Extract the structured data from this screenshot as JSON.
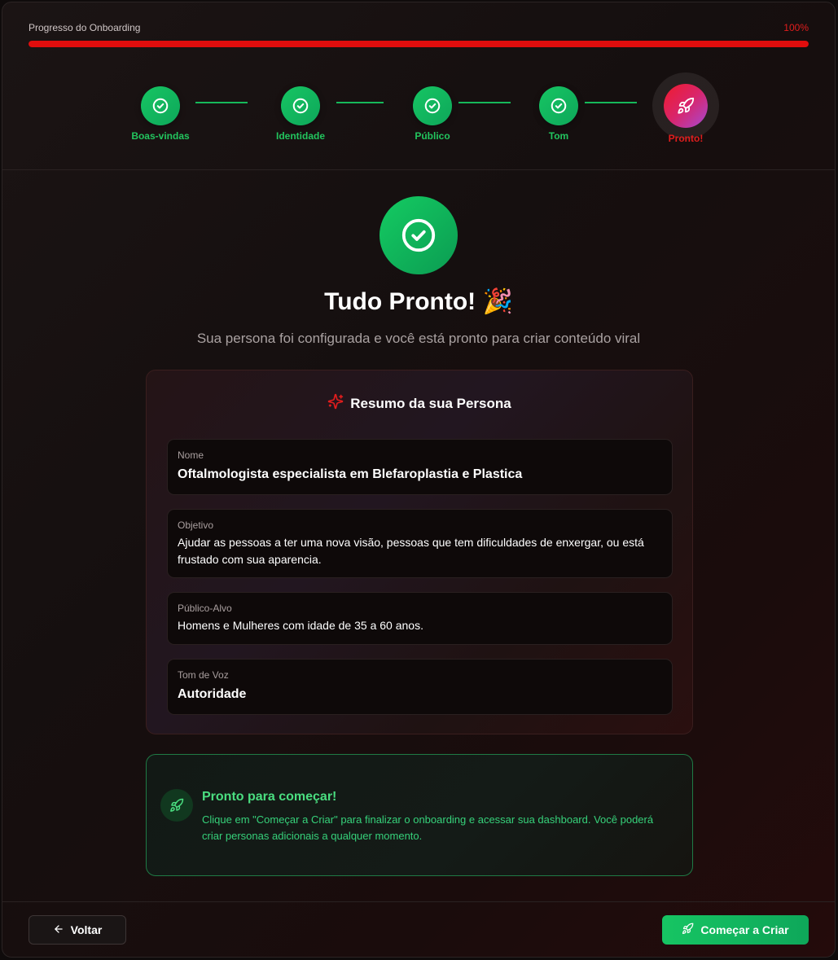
{
  "progress": {
    "label": "Progresso do Onboarding",
    "percent_text": "100%",
    "value": 1.0
  },
  "steps": [
    {
      "label": "Boas-vindas",
      "icon": "check-circle-icon",
      "state": "complete"
    },
    {
      "label": "Identidade",
      "icon": "check-circle-icon",
      "state": "complete"
    },
    {
      "label": "Público",
      "icon": "check-circle-icon",
      "state": "complete"
    },
    {
      "label": "Tom",
      "icon": "check-circle-icon",
      "state": "complete"
    },
    {
      "label": "Pronto!",
      "icon": "rocket-icon",
      "state": "current"
    }
  ],
  "hero": {
    "title": "Tudo Pronto! 🎉",
    "subtitle": "Sua persona foi configurada e você está pronto para criar conteúdo viral",
    "icon": "check-circle-icon"
  },
  "summary": {
    "title": "Resumo da sua Persona",
    "icon": "sparkles-icon",
    "fields": [
      {
        "label": "Nome",
        "value": "Oftalmologista especialista em Blefaroplastia e Plastica"
      },
      {
        "label": "Objetivo",
        "value": "Ajudar as pessoas a ter uma nova visão, pessoas que tem dificuldades de enxergar, ou está frustado com sua aparencia."
      },
      {
        "label": "Público-Alvo",
        "value": "Homens e Mulheres com idade de 35 a 60 anos."
      },
      {
        "label": "Tom de Voz",
        "value": "Autoridade"
      }
    ]
  },
  "ready": {
    "title": "Pronto para começar!",
    "text": "Clique em \"Começar a Criar\" para finalizar o onboarding e acessar sua dashboard. Você poderá criar personas adicionais a qualquer momento.",
    "icon": "rocket-icon"
  },
  "footer": {
    "back_label": "Voltar",
    "back_icon": "arrow-left-icon",
    "start_label": "Começar a Criar",
    "start_icon": "rocket-icon"
  },
  "colors": {
    "accent_red": "#e00d0d",
    "success_green": "#16c563",
    "background": "#150f0f"
  }
}
